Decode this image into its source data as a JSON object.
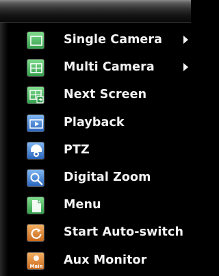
{
  "colors": {
    "background": "#000000",
    "text": "#f4f4f4",
    "green_icon": "#3fae5a",
    "blue_icon": "#2f6fc4",
    "orange_icon": "#d8782a"
  },
  "menu": {
    "items": [
      {
        "label": "Single Camera",
        "icon": "single-camera-icon",
        "submenu": true
      },
      {
        "label": "Multi Camera",
        "icon": "multi-camera-icon",
        "submenu": true
      },
      {
        "label": "Next Screen",
        "icon": "next-screen-icon",
        "submenu": false
      },
      {
        "label": "Playback",
        "icon": "playback-icon",
        "submenu": false
      },
      {
        "label": "PTZ",
        "icon": "ptz-icon",
        "submenu": false
      },
      {
        "label": "Digital Zoom",
        "icon": "magnifier-icon",
        "submenu": false
      },
      {
        "label": "Menu",
        "icon": "menu-document-icon",
        "submenu": false
      },
      {
        "label": "Start Auto-switch",
        "icon": "auto-switch-icon",
        "submenu": false
      },
      {
        "label": "Aux Monitor",
        "icon": "aux-monitor-icon",
        "icon_text": "Main",
        "submenu": false
      }
    ]
  }
}
